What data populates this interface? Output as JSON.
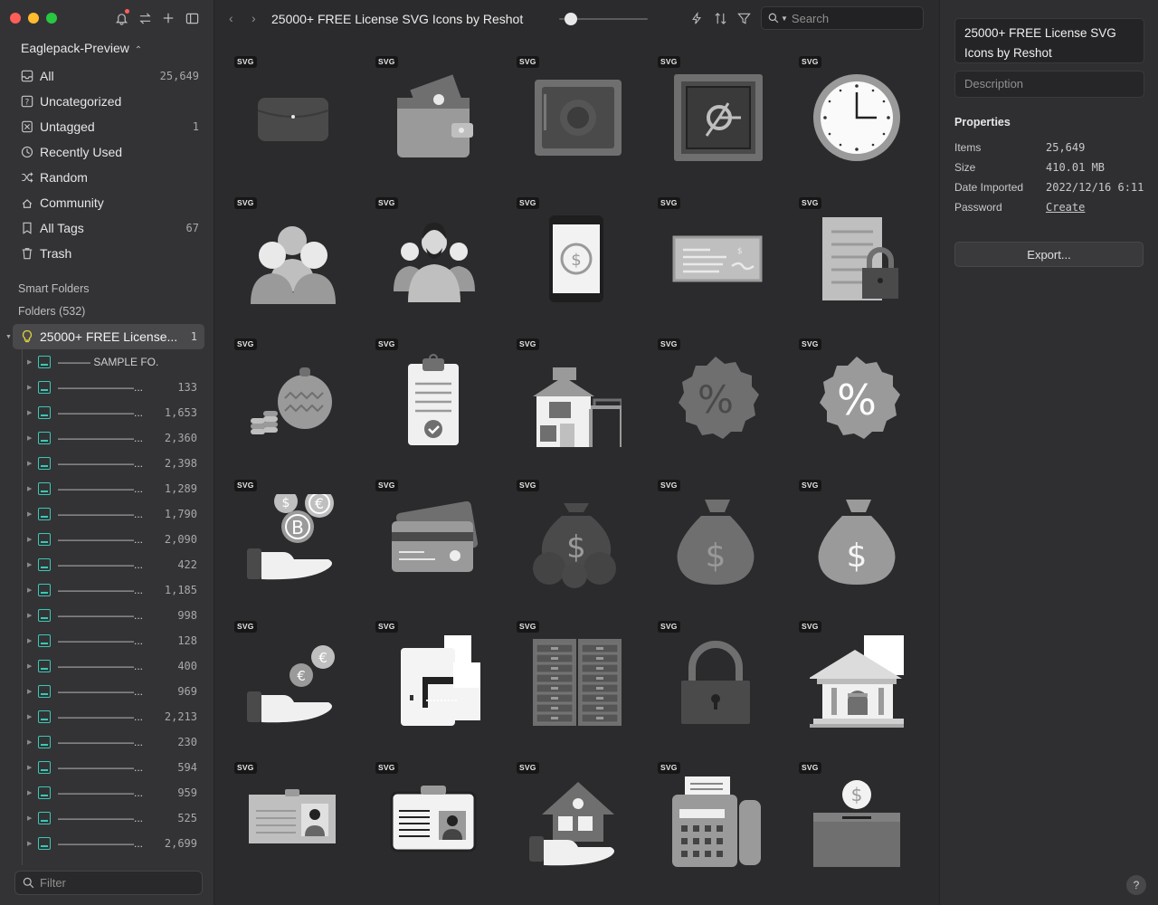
{
  "window": {
    "traffic": {
      "close": "#ff5f57",
      "minimize": "#febc2e",
      "zoom": "#28c840"
    }
  },
  "sidebar": {
    "library_name": "Eaglepack-Preview",
    "library_chevron": "⌃",
    "nav": [
      {
        "label": "All",
        "count": "25,649",
        "icon": "inbox-icon"
      },
      {
        "label": "Uncategorized",
        "count": "",
        "icon": "question-icon"
      },
      {
        "label": "Untagged",
        "count": "1",
        "icon": "untagged-icon"
      },
      {
        "label": "Recently Used",
        "count": "",
        "icon": "clock-icon"
      },
      {
        "label": "Random",
        "count": "",
        "icon": "shuffle-icon"
      },
      {
        "label": "Community",
        "count": "",
        "icon": "community-icon"
      },
      {
        "label": "All Tags",
        "count": "67",
        "icon": "tag-icon"
      },
      {
        "label": "Trash",
        "count": "",
        "icon": "trash-icon"
      }
    ],
    "smart_folders_label": "Smart Folders",
    "folders_label": "Folders (532)",
    "active_folder": {
      "label": "25000+ FREE License...",
      "count": "1"
    },
    "subfolders": [
      {
        "name": "——— SAMPLE FO...",
        "count": ""
      },
      {
        "name": "———————...",
        "count": "133"
      },
      {
        "name": "———————...",
        "count": "1,653"
      },
      {
        "name": "———————...",
        "count": "2,360"
      },
      {
        "name": "———————...",
        "count": "2,398"
      },
      {
        "name": "———————...",
        "count": "1,289"
      },
      {
        "name": "———————...",
        "count": "1,790"
      },
      {
        "name": "———————...",
        "count": "2,090"
      },
      {
        "name": "———————...",
        "count": "422"
      },
      {
        "name": "———————...",
        "count": "1,185"
      },
      {
        "name": "———————...",
        "count": "998"
      },
      {
        "name": "———————...",
        "count": "128"
      },
      {
        "name": "———————...",
        "count": "400"
      },
      {
        "name": "———————...",
        "count": "969"
      },
      {
        "name": "———————...",
        "count": "2,213"
      },
      {
        "name": "———————...",
        "count": "230"
      },
      {
        "name": "———————...",
        "count": "594"
      },
      {
        "name": "———————...",
        "count": "959"
      },
      {
        "name": "———————...",
        "count": "525"
      },
      {
        "name": "———————...",
        "count": "2,699"
      }
    ],
    "filter_placeholder": "Filter"
  },
  "main": {
    "title": "25000+ FREE License SVG Icons by Reshot",
    "back_glyph": "‹",
    "forward_glyph": "›",
    "thumbnail_size": 0.12,
    "search_placeholder": "Search",
    "badge": "SVG",
    "items": [
      "wallet-icon",
      "wallet-money-icon",
      "safe-icon",
      "vault-icon",
      "clock-icon",
      "people-group-icon",
      "business-team-icon",
      "phone-dollar-icon",
      "check-icon",
      "document-lock-icon",
      "coins-piggy-icon",
      "clipboard-check-icon",
      "house-icon",
      "percent-badge-icon",
      "percent-badge-light-icon",
      "hand-crypto-coins-icon",
      "credit-cards-icon",
      "money-bags-icon",
      "money-bag-icon",
      "money-bag-light-icon",
      "hand-euro-coins-icon",
      "wallet-cards-icon",
      "filing-cabinet-icon",
      "padlock-icon",
      "bank-icon",
      "id-card-icon",
      "badge-id-icon",
      "hand-house-icon",
      "fax-machine-icon",
      "donation-box-icon"
    ]
  },
  "panel": {
    "item_title": "25000+ FREE License SVG Icons by Reshot",
    "description_placeholder": "Description",
    "properties_header": "Properties",
    "props": [
      {
        "key": "Items",
        "value": "25,649"
      },
      {
        "key": "Size",
        "value": "410.01 MB"
      },
      {
        "key": "Date Imported",
        "value": "2022/12/16 6:11"
      },
      {
        "key": "Password",
        "value": "Create"
      }
    ],
    "export_label": "Export...",
    "help_label": "?"
  }
}
